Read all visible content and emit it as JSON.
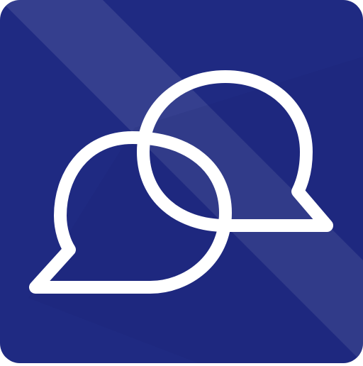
{
  "icon": {
    "name": "chat-bubbles-app-icon",
    "glyph": "two-overlapping-speech-bubbles-icon"
  },
  "colors": {
    "background": "#1f2a82",
    "background_light": "#2a3aa0",
    "background_shadow": "#1a236f",
    "stroke": "#ffffff"
  }
}
